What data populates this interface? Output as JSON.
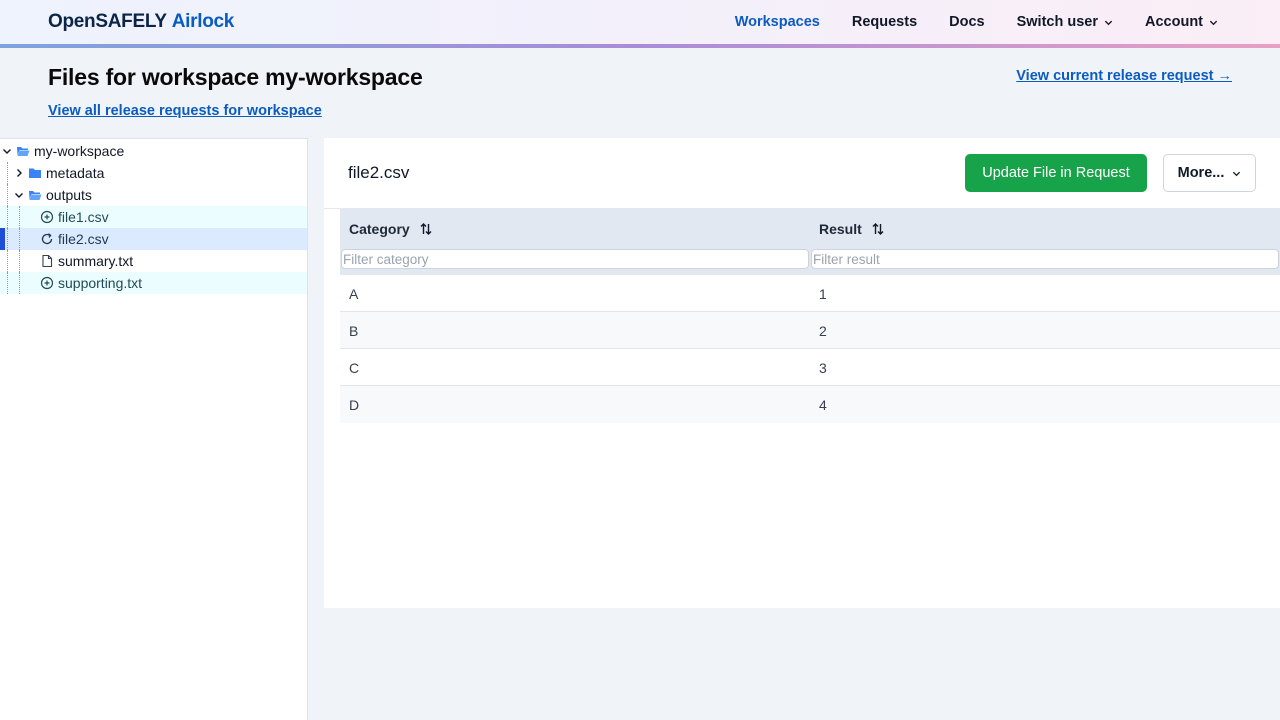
{
  "header": {
    "brand_primary": "OpenSAFELY",
    "brand_secondary": "Airlock",
    "nav": [
      {
        "label": "Workspaces",
        "active": true
      },
      {
        "label": "Requests"
      },
      {
        "label": "Docs"
      },
      {
        "label": "Switch user",
        "dropdown": true
      },
      {
        "label": "Account",
        "dropdown": true
      }
    ]
  },
  "page": {
    "title": "Files for workspace my-workspace",
    "current_release_link": "View current release request →",
    "all_requests_link": "View all release requests for workspace"
  },
  "tree": {
    "items": [
      {
        "label": "my-workspace",
        "type": "folder-open",
        "state": "expanded"
      },
      {
        "label": "metadata",
        "type": "folder",
        "state": "collapsed"
      },
      {
        "label": "outputs",
        "type": "folder-open",
        "state": "expanded"
      },
      {
        "label": "file1.csv",
        "type": "file-added"
      },
      {
        "label": "file2.csv",
        "type": "file-updated",
        "selected": true
      },
      {
        "label": "summary.txt",
        "type": "file"
      },
      {
        "label": "supporting.txt",
        "type": "file-added"
      }
    ]
  },
  "content": {
    "file_name": "file2.csv",
    "update_button": "Update File in Request",
    "more_button": "More...",
    "table": {
      "columns": [
        {
          "label": "Category",
          "filter_placeholder": "Filter category"
        },
        {
          "label": "Result",
          "filter_placeholder": "Filter result"
        }
      ],
      "rows": [
        [
          "A",
          "1"
        ],
        [
          "B",
          "2"
        ],
        [
          "C",
          "3"
        ],
        [
          "D",
          "4"
        ]
      ]
    }
  },
  "colors": {
    "accent": "#0b5bc1",
    "primary_button": "#17a34a",
    "selection": "#1d4ed8"
  }
}
